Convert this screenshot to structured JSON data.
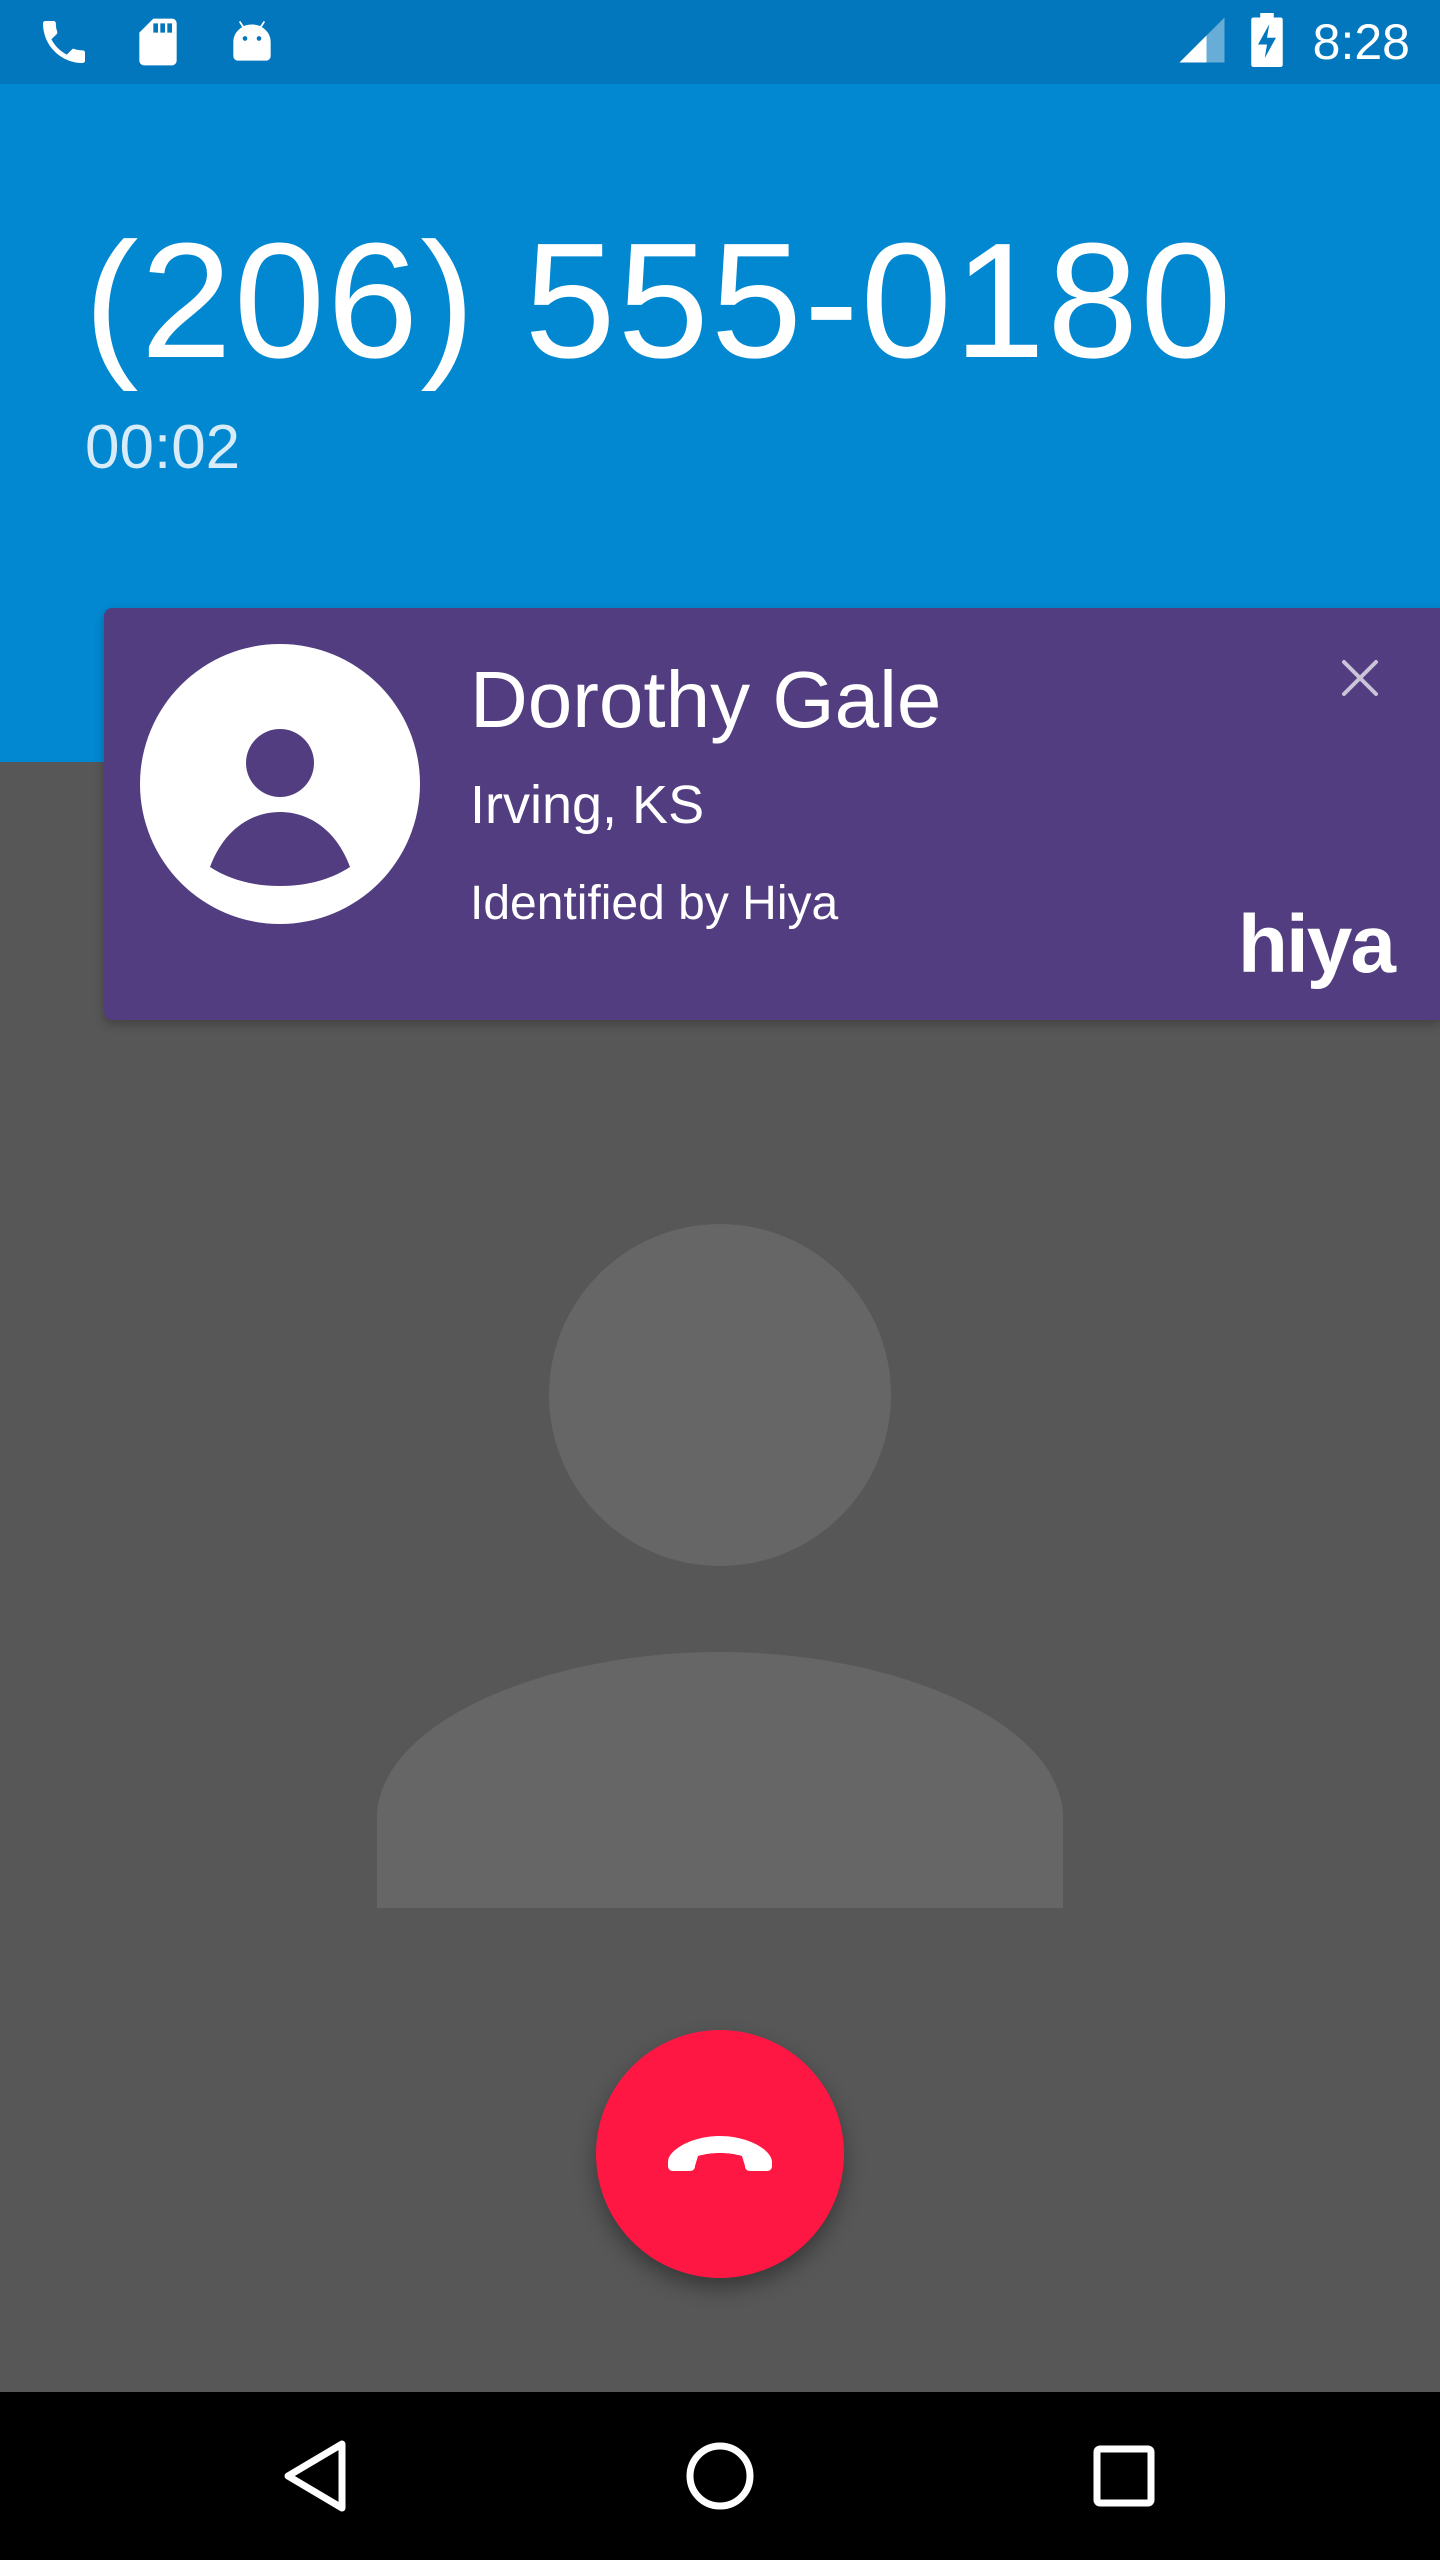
{
  "status_bar": {
    "time": "8:28",
    "left_icons": [
      "phone-icon",
      "sd-card-icon",
      "android-icon"
    ],
    "right_icons": [
      "cell-signal-icon",
      "battery-charging-icon"
    ]
  },
  "call": {
    "phone_number": "(206) 555-0180",
    "timer": "00:02"
  },
  "caller_card": {
    "name": "Dorothy Gale",
    "location": "Irving, KS",
    "identified_by": "Identified by Hiya",
    "logo_text": "hiya",
    "close_icon": "close-icon"
  },
  "actions": {
    "end_call_icon": "end-call-icon"
  },
  "nav_bar": {
    "buttons": [
      "back-icon",
      "home-icon",
      "recents-icon"
    ]
  },
  "colors": {
    "status_bar": "#0277bd",
    "header": "#0288d1",
    "background": "#575757",
    "card": "#523d80",
    "end_call": "#ff1744",
    "nav_bar": "#000000"
  }
}
